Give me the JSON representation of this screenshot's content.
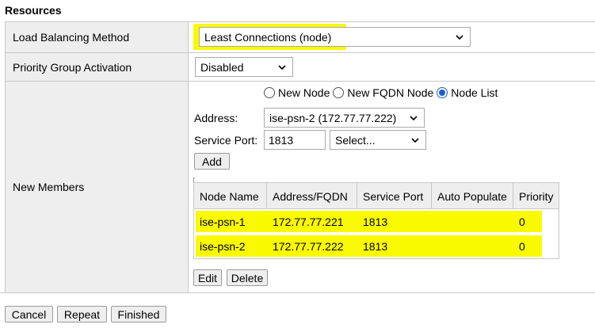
{
  "section": {
    "title": "Resources"
  },
  "load_balancing": {
    "label": "Load Balancing Method",
    "selected": "Least Connections (node)"
  },
  "priority_group": {
    "label": "Priority Group Activation",
    "selected": "Disabled"
  },
  "new_members": {
    "label": "New Members",
    "radios": [
      {
        "label": "New Node",
        "checked": false
      },
      {
        "label": "New FQDN Node",
        "checked": false
      },
      {
        "label": "Node List",
        "checked": true
      }
    ],
    "address_label": "Address:",
    "address_selected": "ise-psn-2 (172.77.77.222)",
    "service_port_label": "Service Port:",
    "service_port_value": "1813",
    "service_select": "Select...",
    "add_label": "Add",
    "table": {
      "headers": [
        "Node Name",
        "Address/FQDN",
        "Service Port",
        "Auto Populate",
        "Priority"
      ],
      "rows": [
        {
          "node": "ise-psn-1",
          "address": "172.77.77.221",
          "port": "1813",
          "auto": "",
          "priority": "0"
        },
        {
          "node": "ise-psn-2",
          "address": "172.77.77.222",
          "port": "1813",
          "auto": "",
          "priority": "0"
        }
      ]
    },
    "edit_label": "Edit",
    "delete_label": "Delete"
  },
  "footer": {
    "cancel": "Cancel",
    "repeat": "Repeat",
    "finished": "Finished"
  },
  "colors": {
    "highlight": "#ffff00",
    "label_bg": "#eeeeee",
    "radio_checked": "#1a5fd0"
  }
}
